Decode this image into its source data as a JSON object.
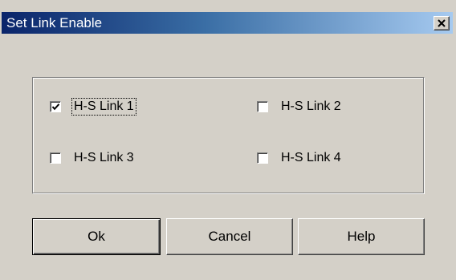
{
  "window": {
    "title": "Set Link Enable",
    "close_icon": "close-x-icon"
  },
  "links": [
    {
      "label": "H-S Link 1",
      "checked": true
    },
    {
      "label": "H-S Link 2",
      "checked": false
    },
    {
      "label": "H-S Link 3",
      "checked": false
    },
    {
      "label": "H-S Link 4",
      "checked": false
    }
  ],
  "buttons": {
    "ok_label": "Ok",
    "cancel_label": "Cancel",
    "help_label": "Help"
  },
  "colors": {
    "dialog_bg": "#d4d0c8",
    "title_gradient_start": "#0a246a",
    "title_gradient_end": "#a6caf0"
  }
}
